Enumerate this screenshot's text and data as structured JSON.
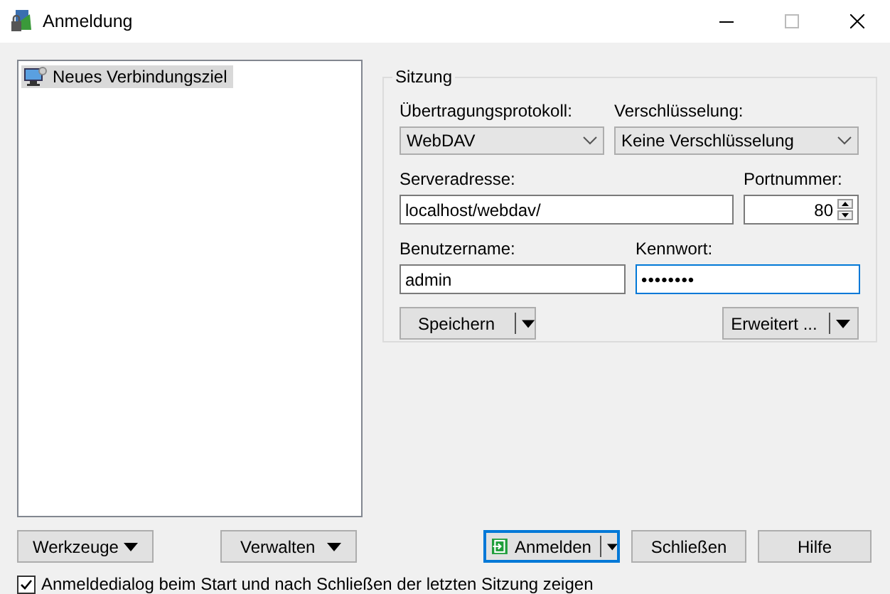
{
  "window": {
    "title": "Anmeldung"
  },
  "sites": [
    {
      "label": "Neues Verbindungsziel",
      "selected": true
    }
  ],
  "session": {
    "title": "Sitzung",
    "protocol": {
      "label": "Übertragungsprotokoll:",
      "value": "WebDAV"
    },
    "encryption": {
      "label": "Verschlüsselung:",
      "value": "Keine Verschlüsselung"
    },
    "host": {
      "label": "Serveradresse:",
      "value": "localhost/webdav/"
    },
    "port": {
      "label": "Portnummer:",
      "value": "80"
    },
    "user": {
      "label": "Benutzername:",
      "value": "admin"
    },
    "password": {
      "label": "Kennwort:",
      "value": "••••••••"
    },
    "save_button": "Speichern",
    "advanced_button": "Erweitert ..."
  },
  "tools_button": "Werkzeuge",
  "manage_button": "Verwalten",
  "login_button": "Anmelden",
  "close_button": "Schließen",
  "help_button": "Hilfe",
  "show_dialog": {
    "label": "Anmeldedialog beim Start und nach Schließen der letzten Sitzung zeigen",
    "checked": true
  }
}
